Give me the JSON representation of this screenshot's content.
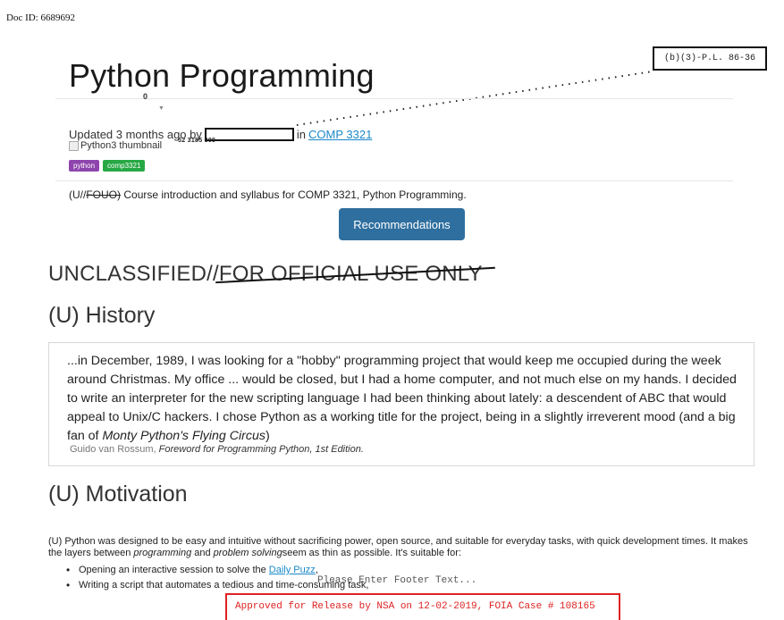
{
  "doc_id": "Doc ID: 6689692",
  "exemption": "(b)(3)-P.L. 86-36",
  "title": "Python Programming",
  "vote_count": "0",
  "vote_down": "▼",
  "updated": {
    "prefix": "Updated 3 months ago by",
    "in_label": "in",
    "course_link": "COMP 3321"
  },
  "thumbnail_alt": "Python3 thumbnail",
  "stats": "52  3185  309",
  "tags": [
    "python",
    "comp3321"
  ],
  "summary": {
    "marking_u": "(U//",
    "marking_struck": "FOUO)",
    "text": " Course introduction and syllabus for COMP 3321, Python Programming."
  },
  "recommend_button": "Recommendations",
  "classification": {
    "plain": "UNCLASSIFIED//",
    "struck": "FOR OFFICIAL USE ONLY"
  },
  "history_heading": "(U) History",
  "quote": {
    "text_before": "...in December, 1989, I was looking for a \"hobby\" programming project that would keep me occupied during the week around Christmas. My office ... would be closed, but I had a home computer, and not much else on my hands. I decided to write an interpreter for the new scripting language I had been thinking about lately: a descendent of ABC that would appeal to Unix/C hackers. I chose Python as a working title for the project, being in a slightly irreverent mood (and a big fan of ",
    "text_italic": "Monty Python's Flying Circus",
    "text_after": ")",
    "author": "Guido van Rossum, ",
    "source": "Foreword for Programming Python, 1st Edition."
  },
  "motivation_heading": "(U) Motivation",
  "motivation": {
    "p1": "(U) Python was designed to be easy and intuitive without sacrificing power, open source, and suitable for everyday tasks, with quick development times. It makes the layers between ",
    "em1": "programming",
    "p2": " and ",
    "em2": "problem solving",
    "p3": "seem as thin as possible. It's suitable for:"
  },
  "bullets": {
    "item1_prefix": "Opening an interactive session to solve the ",
    "item1_link": "Daily Puzz",
    "item1_suffix": ",",
    "item2": "Writing a script that automates a tedious and time-consuming task,"
  },
  "footer_placeholder": "Please Enter Footer Text...",
  "release_stamp": "Approved for Release by NSA on 12-02-2019, FOIA Case # 108165",
  "colors": {
    "link": "#1a88c9",
    "button": "#2f6f9f",
    "tag_python": "#8e44ad",
    "tag_comp": "#27a844",
    "release": "#d22222"
  }
}
